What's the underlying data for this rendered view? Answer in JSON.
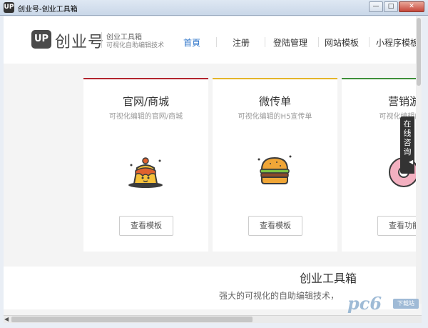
{
  "window": {
    "title": "创业号-创业工具箱",
    "app_icon": "UP"
  },
  "header": {
    "logo_mark": "UP",
    "logo_text": "创业号",
    "brand_name": "创业工具箱",
    "brand_sub": "可视化自助编辑技术"
  },
  "nav": {
    "items": [
      "首頁",
      "注册",
      "登陆管理",
      "网站模板",
      "小程序模板"
    ],
    "active": 0,
    "accent_color": "#2d74c9"
  },
  "cards": [
    {
      "title": "官网/商城",
      "desc": "可视化编辑的官网/商城",
      "button": "查看模板",
      "accent": "#b2252e",
      "icon": "pudding-icon"
    },
    {
      "title": "微传单",
      "desc": "可视化编辑的H5宣传单",
      "button": "查看模板",
      "accent": "#e3b52a",
      "icon": "burger-icon"
    },
    {
      "title": "营销游",
      "desc": "可视化编辑的营",
      "button": "查看功能",
      "accent": "#3e8f3a",
      "icon": "donut-icon"
    }
  ],
  "consult": {
    "label": "在线咨询"
  },
  "lower": {
    "title": "创业工具箱",
    "subtitle": "强大的可视化的自助编辑技术，"
  },
  "watermark": {
    "text": "pc6",
    "badge": "下载站"
  }
}
